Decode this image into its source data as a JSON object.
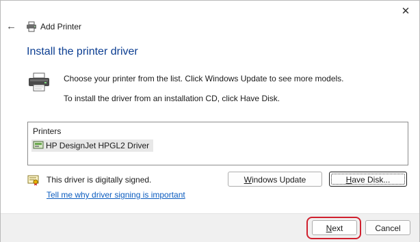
{
  "window": {
    "title": "Add Printer",
    "close_glyph": "✕",
    "back_glyph": "←"
  },
  "heading": "Install the printer driver",
  "instructions": {
    "line1": "Choose your printer from the list. Click Windows Update to see more models.",
    "line2": "To install the driver from an installation CD, click Have Disk."
  },
  "printer_list": {
    "header": "Printers",
    "items": [
      {
        "label": "HP DesignJet HPGL2 Driver",
        "icon": "printer-driver-icon",
        "selected": true
      }
    ]
  },
  "signature": {
    "status": "This driver is digitally signed.",
    "link": "Tell me why driver signing is important",
    "icon": "certificate-icon"
  },
  "buttons": {
    "windows_update": {
      "access_key": "W",
      "rest": "indows Update"
    },
    "have_disk": {
      "access_key": "H",
      "rest": "ave Disk..."
    },
    "next": {
      "access_key": "N",
      "rest": "ext"
    },
    "cancel": "Cancel"
  },
  "colors": {
    "heading": "#0b3d91",
    "link": "#0a5bbf",
    "highlight": "#d0202e",
    "footer_bg": "#f0f0f0"
  }
}
